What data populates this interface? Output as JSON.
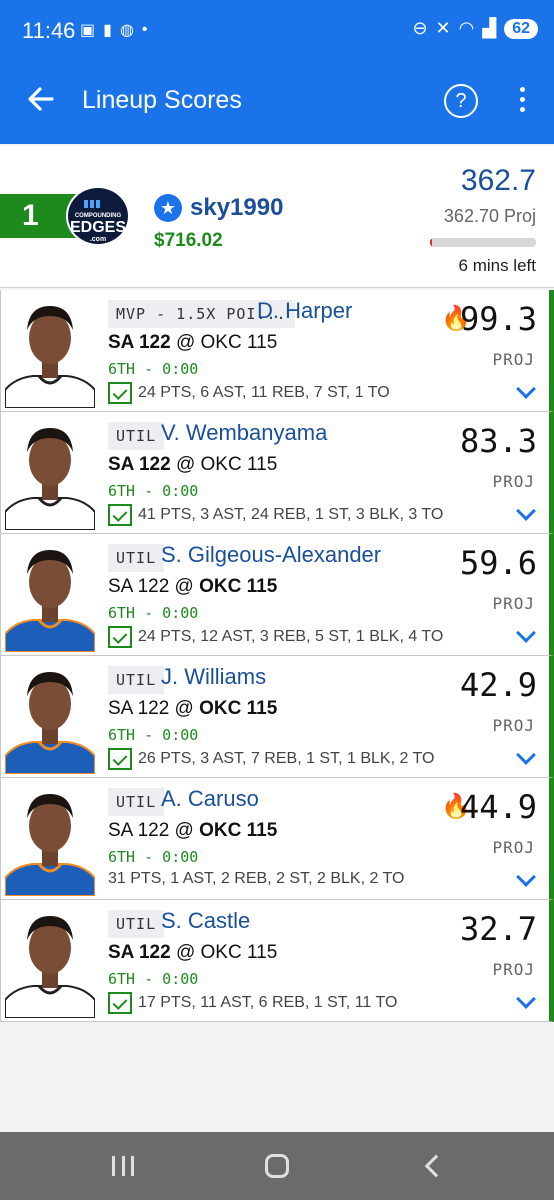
{
  "status_bar": {
    "time": "11:46",
    "battery": "62"
  },
  "app_bar": {
    "title": "Lineup Scores"
  },
  "summary": {
    "rank": "1",
    "logo_text_top": "COMPOUNDING",
    "logo_text_main": "EDGES",
    "logo_text_sub": ".com",
    "username": "sky1990",
    "winnings": "$716.02",
    "score": "362.7",
    "projection": "362.70 Proj",
    "time_left": "6 mins left",
    "progress_fraction": 0.02
  },
  "players": [
    {
      "position": "MVP - 1.5X POI...",
      "name": "D. Harper",
      "game_pre": "SA 122",
      "game_at": " @ ",
      "game_post": "OKC 115",
      "bold_team": "left",
      "period": "6TH - 0:00",
      "stats": "24 PTS, 6 AST, 11 REB, 7 ST, 1 TO",
      "checked": true,
      "points": "99.3",
      "hot": true,
      "proj_label": "PROJ"
    },
    {
      "position": "UTIL",
      "name": "V. Wembanyama",
      "game_pre": "SA 122",
      "game_at": " @ ",
      "game_post": "OKC 115",
      "bold_team": "left",
      "period": "6TH - 0:00",
      "stats": "41 PTS, 3 AST, 24 REB, 1 ST, 3 BLK, 3 TO",
      "checked": true,
      "points": "83.3",
      "hot": false,
      "proj_label": "PROJ"
    },
    {
      "position": "UTIL",
      "name": "S. Gilgeous-Alexander",
      "game_pre": "SA 122",
      "game_at": " @ ",
      "game_post": "OKC 115",
      "bold_team": "right",
      "period": "6TH - 0:00",
      "stats": "24 PTS, 12 AST, 3 REB, 5 ST, 1 BLK, 4 TO",
      "checked": true,
      "points": "59.6",
      "hot": false,
      "proj_label": "PROJ"
    },
    {
      "position": "UTIL",
      "name": "J. Williams",
      "game_pre": "SA 122",
      "game_at": " @ ",
      "game_post": "OKC 115",
      "bold_team": "right",
      "period": "6TH - 0:00",
      "stats": "26 PTS, 3 AST, 7 REB, 1 ST, 1 BLK, 2 TO",
      "checked": true,
      "points": "42.9",
      "hot": false,
      "proj_label": "PROJ"
    },
    {
      "position": "UTIL",
      "name": "A. Caruso",
      "game_pre": "SA 122",
      "game_at": " @ ",
      "game_post": "OKC 115",
      "bold_team": "right",
      "period": "6TH - 0:00",
      "stats": "31 PTS, 1 AST, 2 REB, 2 ST, 2 BLK, 2 TO",
      "checked": false,
      "points": "44.9",
      "hot": true,
      "proj_label": "PROJ"
    },
    {
      "position": "UTIL",
      "name": "S. Castle",
      "game_pre": "SA 122",
      "game_at": " @ ",
      "game_post": "OKC 115",
      "bold_team": "left",
      "period": "6TH - 0:00",
      "stats": "17 PTS, 11 AST, 6 REB, 1 ST, 11 TO",
      "checked": true,
      "points": "32.7",
      "hot": false,
      "proj_label": "PROJ"
    }
  ],
  "colors": {
    "primary": "#1a73e8",
    "green": "#1e8a1e",
    "name_blue": "#1a4f9c"
  }
}
